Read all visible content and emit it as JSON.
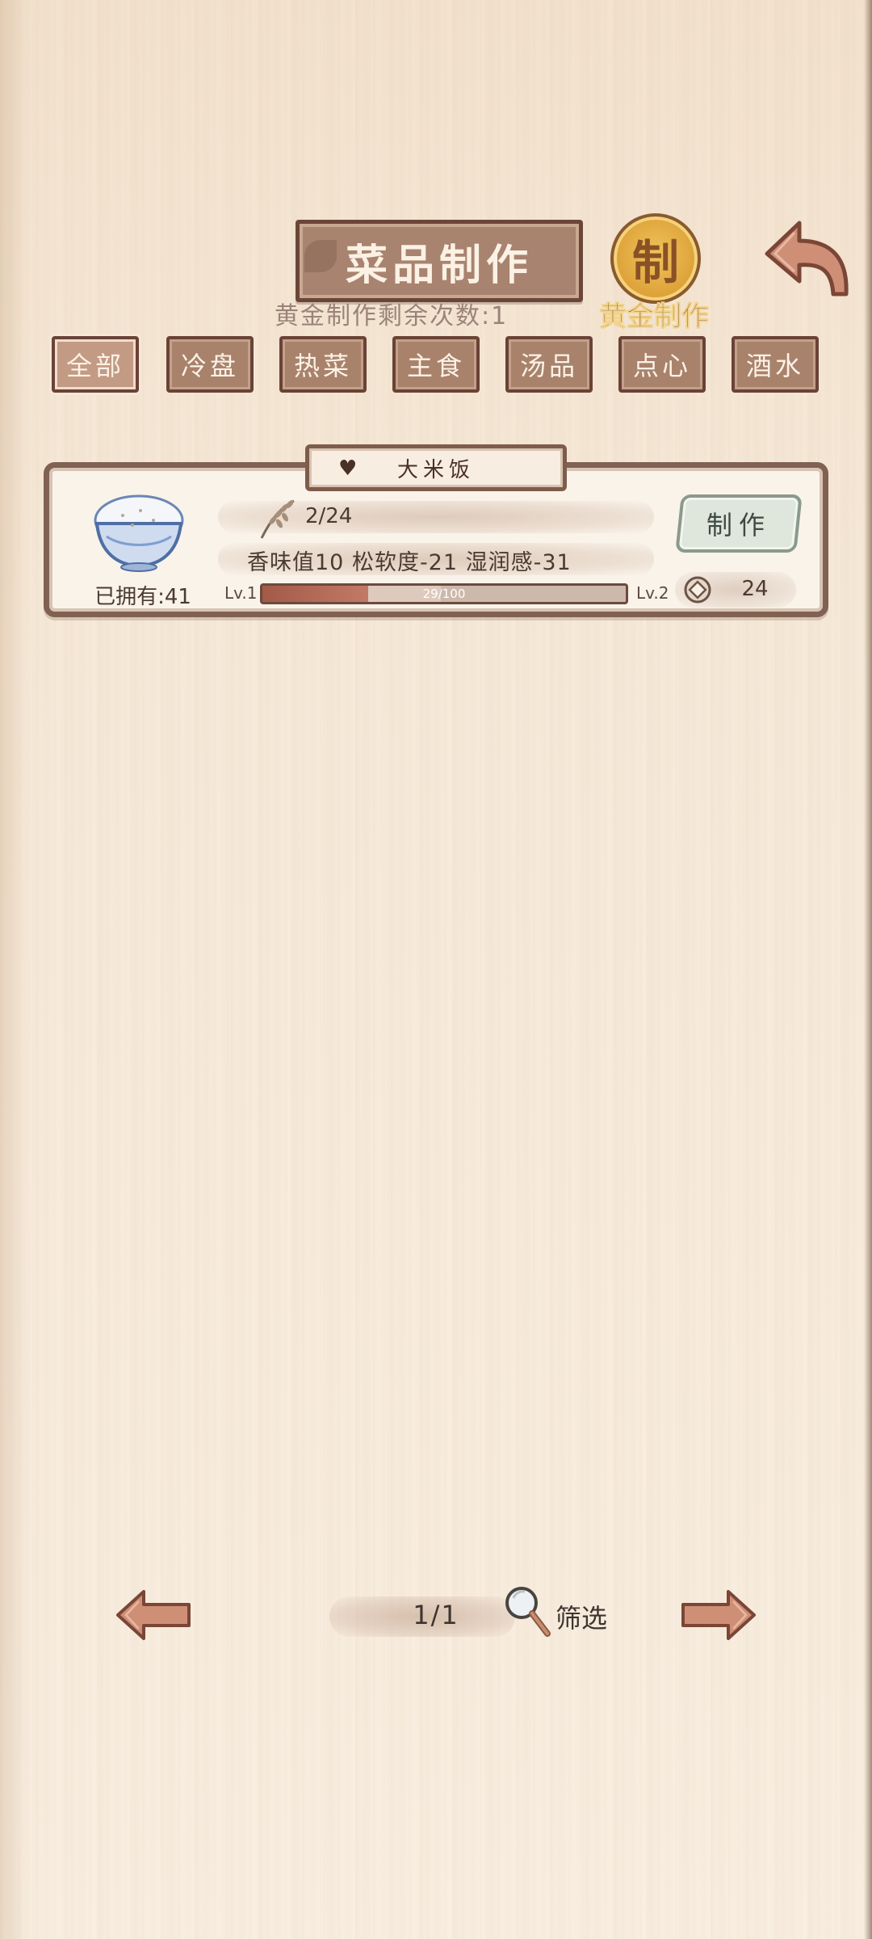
{
  "header": {
    "title": "菜品制作",
    "gold_craft_remaining": "黄金制作剩余次数:1",
    "gold_seal_glyph": "制",
    "gold_craft_label": "黄金制作"
  },
  "tabs": [
    {
      "label": "全部",
      "active": true
    },
    {
      "label": "冷盘",
      "active": false
    },
    {
      "label": "热菜",
      "active": false
    },
    {
      "label": "主食",
      "active": false
    },
    {
      "label": "汤品",
      "active": false
    },
    {
      "label": "点心",
      "active": false
    },
    {
      "label": "酒水",
      "active": false
    }
  ],
  "recipe": {
    "name": "大米饭",
    "owned": "已拥有:41",
    "ingredient_count": "2/24",
    "stats": "香味值10  松软度-21  湿润感-31",
    "level_current": "Lv.1",
    "level_next": "Lv.2",
    "xp_text": "29/100",
    "xp_fraction": 0.29,
    "make_label": "制作",
    "cost": "24"
  },
  "pagination": {
    "page": "1/1",
    "filter_label": "筛选"
  },
  "icons": {
    "back": "back-arrow-icon",
    "bowl": "rice-bowl-icon",
    "wheat": "rice-stalk-icon",
    "coin": "copper-coin-icon",
    "magnifier": "magnifier-icon",
    "prev": "left-arrow-icon",
    "next": "right-arrow-icon"
  },
  "colors": {
    "plaque": "#a8836f",
    "plaque_border": "#6b4638",
    "gold": "#dca037",
    "xp_fill": "#a35a48",
    "make_button": "#dfe6dc"
  }
}
